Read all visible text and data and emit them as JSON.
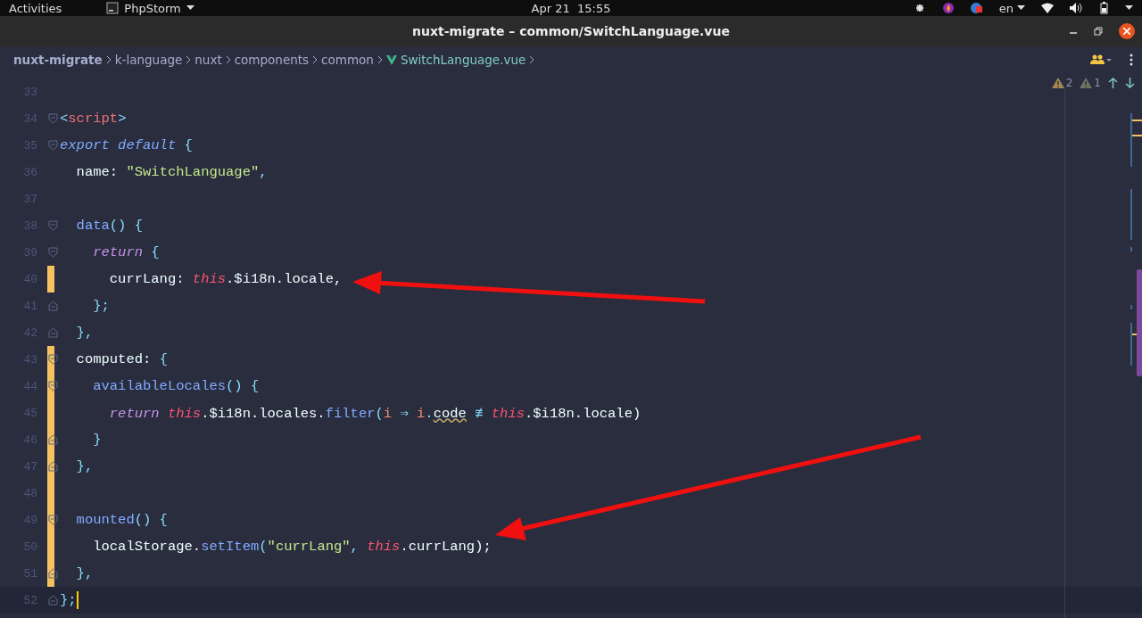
{
  "top_bar": {
    "activities": "Activities",
    "app_menu": "PhpStorm",
    "clock": "Apr 21  15:55",
    "keyboard_layout": "en"
  },
  "window": {
    "title": "nuxt-migrate – common/SwitchLanguage.vue"
  },
  "breadcrumbs": [
    {
      "label": "nuxt-migrate",
      "kind": "project"
    },
    {
      "label": "k-language",
      "kind": "folder"
    },
    {
      "label": "nuxt",
      "kind": "folder"
    },
    {
      "label": "components",
      "kind": "folder"
    },
    {
      "label": "common",
      "kind": "folder"
    },
    {
      "label": "SwitchLanguage.vue",
      "kind": "vue-file"
    }
  ],
  "inspections": [
    {
      "count": "2",
      "kind": "warning"
    },
    {
      "count": "1",
      "kind": "weak-warning"
    }
  ],
  "editor": {
    "lines": [
      {
        "number": "33",
        "modified": false,
        "fold_start": false,
        "fold_end": false,
        "current": false
      },
      {
        "number": "34",
        "modified": false,
        "fold_start": true,
        "fold_end": false,
        "current": false,
        "tokens": [
          {
            "text": "<",
            "kind": "punct"
          },
          {
            "text": "script",
            "kind": "tag"
          },
          {
            "text": ">",
            "kind": "punct"
          }
        ]
      },
      {
        "number": "35",
        "modified": false,
        "fold_start": true,
        "fold_end": false,
        "current": false,
        "tokens": [
          {
            "text": "export default",
            "kind": "keyword"
          },
          {
            "text": " {",
            "kind": "punct"
          }
        ]
      },
      {
        "number": "36",
        "modified": false,
        "fold_start": false,
        "fold_end": false,
        "current": false,
        "tokens": [
          {
            "text": "  name: ",
            "kind": "plain"
          },
          {
            "text": "\"SwitchLanguage\"",
            "kind": "string"
          },
          {
            "text": ",",
            "kind": "punct"
          }
        ]
      },
      {
        "number": "37",
        "modified": false,
        "fold_start": false,
        "fold_end": false,
        "current": false
      },
      {
        "number": "38",
        "modified": false,
        "fold_start": true,
        "fold_end": false,
        "current": false,
        "tokens": [
          {
            "text": "  data",
            "kind": "func"
          },
          {
            "text": "() {",
            "kind": "punct"
          }
        ]
      },
      {
        "number": "39",
        "modified": false,
        "fold_start": true,
        "fold_end": false,
        "current": false,
        "tokens": [
          {
            "text": "    return",
            "kind": "return"
          },
          {
            "text": " {",
            "kind": "punct"
          }
        ]
      },
      {
        "number": "40",
        "modified": true,
        "fold_start": false,
        "fold_end": false,
        "current": false,
        "tokens": [
          {
            "text": "      currLang: ",
            "kind": "plain"
          },
          {
            "text": "this",
            "kind": "this"
          },
          {
            "text": ".$i18n.locale,",
            "kind": "plain"
          }
        ]
      },
      {
        "number": "41",
        "modified": false,
        "fold_start": false,
        "fold_end": true,
        "current": false,
        "tokens": [
          {
            "text": "    };",
            "kind": "punct"
          }
        ]
      },
      {
        "number": "42",
        "modified": false,
        "fold_start": false,
        "fold_end": true,
        "current": false,
        "tokens": [
          {
            "text": "  },",
            "kind": "punct"
          }
        ]
      },
      {
        "number": "43",
        "modified": true,
        "fold_start": true,
        "fold_end": false,
        "current": false,
        "tokens": [
          {
            "text": "  computed: ",
            "kind": "plain"
          },
          {
            "text": "{",
            "kind": "punct"
          }
        ]
      },
      {
        "number": "44",
        "modified": true,
        "fold_start": true,
        "fold_end": false,
        "current": false,
        "tokens": [
          {
            "text": "    availableLocales",
            "kind": "func"
          },
          {
            "text": "() {",
            "kind": "punct"
          }
        ]
      },
      {
        "number": "45",
        "modified": true,
        "fold_start": false,
        "fold_end": false,
        "current": false,
        "tokens": [
          {
            "text": "      return ",
            "kind": "return"
          },
          {
            "text": "this",
            "kind": "this"
          },
          {
            "text": ".$i18n.locales.",
            "kind": "plain"
          },
          {
            "text": "filter",
            "kind": "func"
          },
          {
            "text": "(",
            "kind": "punct"
          },
          {
            "text": "i",
            "kind": "param"
          },
          {
            "text": " ⇒ ",
            "kind": "punct"
          },
          {
            "text": "i",
            "kind": "param"
          },
          {
            "text": ".",
            "kind": "punct"
          },
          {
            "text": "code",
            "kind": "warn"
          },
          {
            "text": " ≢ ",
            "kind": "punct"
          },
          {
            "text": "this",
            "kind": "this"
          },
          {
            "text": ".$i18n.locale)",
            "kind": "plain"
          }
        ]
      },
      {
        "number": "46",
        "modified": true,
        "fold_start": false,
        "fold_end": true,
        "current": false,
        "tokens": [
          {
            "text": "    }",
            "kind": "punct"
          }
        ]
      },
      {
        "number": "47",
        "modified": true,
        "fold_start": false,
        "fold_end": true,
        "current": false,
        "tokens": [
          {
            "text": "  },",
            "kind": "punct"
          }
        ]
      },
      {
        "number": "48",
        "modified": true,
        "fold_start": false,
        "fold_end": false,
        "current": false
      },
      {
        "number": "49",
        "modified": true,
        "fold_start": true,
        "fold_end": false,
        "current": false,
        "tokens": [
          {
            "text": "  mounted",
            "kind": "func"
          },
          {
            "text": "() {",
            "kind": "punct"
          }
        ]
      },
      {
        "number": "50",
        "modified": true,
        "fold_start": false,
        "fold_end": false,
        "current": false,
        "tokens": [
          {
            "text": "    localStorage.",
            "kind": "plain"
          },
          {
            "text": "setItem",
            "kind": "func"
          },
          {
            "text": "(",
            "kind": "punct"
          },
          {
            "text": "\"currLang\"",
            "kind": "string"
          },
          {
            "text": ", ",
            "kind": "punct"
          },
          {
            "text": "this",
            "kind": "this"
          },
          {
            "text": ".currLang);",
            "kind": "plain"
          }
        ]
      },
      {
        "number": "51",
        "modified": true,
        "fold_start": false,
        "fold_end": true,
        "current": false,
        "tokens": [
          {
            "text": "  },",
            "kind": "punct"
          }
        ]
      },
      {
        "number": "52",
        "modified": false,
        "fold_start": false,
        "fold_end": true,
        "current": true,
        "tokens": [
          {
            "text": "};",
            "kind": "punct"
          }
        ]
      }
    ]
  }
}
